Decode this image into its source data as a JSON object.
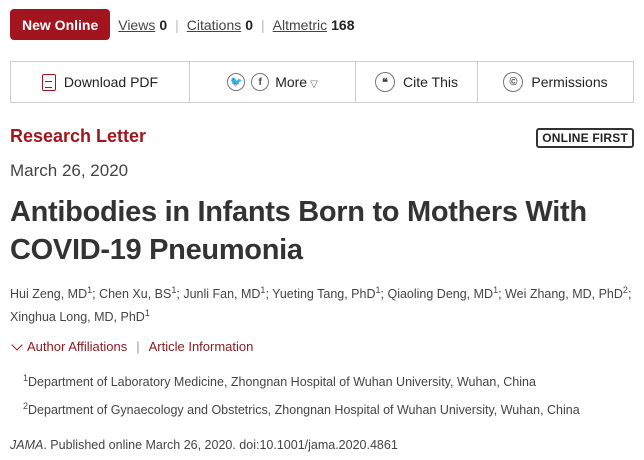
{
  "metrics": {
    "badge": "New Online",
    "views_label": "Views",
    "views_value": "0",
    "citations_label": "Citations",
    "citations_value": "0",
    "altmetric_label": "Altmetric",
    "altmetric_value": "168"
  },
  "toolbar": {
    "download_pdf": "Download PDF",
    "twitter_glyph": "🐦",
    "facebook_glyph": "f",
    "more": "More",
    "cite_glyph": "❝",
    "cite": "Cite This",
    "permissions_glyph": "©",
    "permissions": "Permissions"
  },
  "article": {
    "type": "Research Letter",
    "badge": "ONLINE FIRST",
    "date": "March 26, 2020",
    "title": "Antibodies in Infants Born to Mothers With COVID-19 Pneumonia",
    "authors": [
      {
        "name": "Hui Zeng, MD",
        "sup": "1"
      },
      {
        "name": "Chen Xu, BS",
        "sup": "1"
      },
      {
        "name": "Junli Fan, MD",
        "sup": "1"
      },
      {
        "name": "Yueting Tang, PhD",
        "sup": "1"
      },
      {
        "name": "Qiaoling Deng, MD",
        "sup": "1"
      },
      {
        "name": "Wei Zhang, MD, PhD",
        "sup": "2"
      },
      {
        "name": "Xinghua Long, MD, PhD",
        "sup": "1"
      }
    ],
    "links": {
      "author_affiliations": "Author Affiliations",
      "article_information": "Article Information"
    },
    "affiliations": [
      {
        "sup": "1",
        "text": "Department of Laboratory Medicine, Zhongnan Hospital of Wuhan University, Wuhan, China"
      },
      {
        "sup": "2",
        "text": "Department of Gynaecology and Obstetrics, Zhongnan Hospital of Wuhan University, Wuhan, China"
      }
    ],
    "citation_journal": "JAMA",
    "citation_rest": ". Published online March 26, 2020. doi:10.1001/jama.2020.4861"
  },
  "colors": {
    "accent": "#a3151e"
  },
  "icons": [
    "pdf-icon",
    "twitter-icon",
    "facebook-icon",
    "cite-icon",
    "permissions-icon",
    "chevron-down-icon"
  ]
}
